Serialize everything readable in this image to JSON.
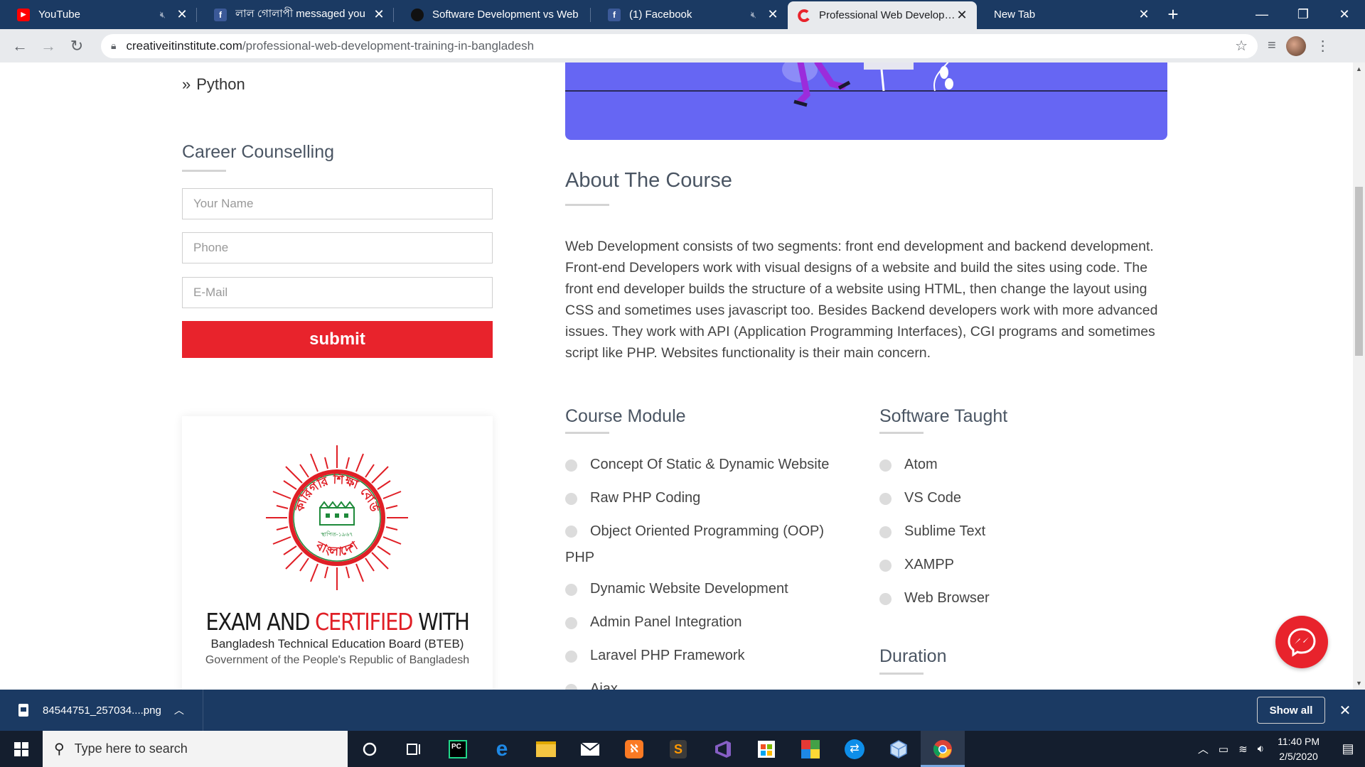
{
  "browser": {
    "tabs": [
      {
        "title": "YouTube",
        "favicon": "youtube-icon",
        "muted": true,
        "active": false
      },
      {
        "title": "লাল গোলাপী messaged you",
        "favicon": "facebook-icon",
        "muted": false,
        "active": false
      },
      {
        "title": "Software Development vs Web",
        "favicon": "github-icon",
        "muted": false,
        "active": false
      },
      {
        "title": "(1) Facebook",
        "favicon": "facebook-icon",
        "muted": true,
        "active": false
      },
      {
        "title": "Professional Web Development",
        "favicon": "creative-it-icon",
        "muted": false,
        "active": true
      },
      {
        "title": "New Tab",
        "favicon": "",
        "muted": false,
        "active": false
      }
    ],
    "url_host": "creativeitinstitute.com",
    "url_path": "/professional-web-development-training-in-bangladesh"
  },
  "sidebar": {
    "list_tail_item": "Python",
    "career": {
      "heading": "Career Counselling",
      "name_placeholder": "Your Name",
      "phone_placeholder": "Phone",
      "email_placeholder": "E-Mail",
      "submit_label": "submit"
    },
    "certificate": {
      "title_part1": "EXAM AND ",
      "title_highlight": "CERTIFIED",
      "title_part2": " WITH",
      "board": "Bangladesh Technical Education Board (BTEB)",
      "government": "Government of the People's Republic of Bangladesh",
      "seal_text_top": "কারিগরি শিক্ষা বোর্ড",
      "seal_text_bottom": "বাংলাদেশ",
      "seal_year": "স্থাপিত-১৯৬৭"
    }
  },
  "main": {
    "about": {
      "heading": "About The Course",
      "body": "Web Development consists of two segments: front end development and backend development. Front-end Developers work with visual designs of a website and build the sites using code. The front end developer builds the structure of a website using HTML, then change the layout using CSS and sometimes uses javascript too. Besides Backend developers work with more advanced issues. They work with API (Application Programming Interfaces), CGI programs and sometimes script like PHP. Websites functionality is their main concern."
    },
    "course_module": {
      "heading": "Course Module",
      "items": [
        "Concept Of Static & Dynamic Website",
        "Raw PHP Coding",
        "Object Oriented Programming (OOP) PHP",
        "Dynamic Website Development",
        "Admin Panel Integration",
        "Laravel PHP Framework",
        "Ajax"
      ]
    },
    "software_taught": {
      "heading": "Software Taught",
      "items": [
        "Atom",
        "VS Code",
        "Sublime Text",
        "XAMPP",
        "Web Browser"
      ]
    },
    "duration": {
      "heading": "Duration"
    }
  },
  "downloads": {
    "file_name": "84544751_257034....png",
    "show_all_label": "Show all"
  },
  "taskbar": {
    "search_placeholder": "Type here to search",
    "time": "11:40 PM",
    "date": "2/5/2020",
    "apps": [
      "cortana-icon",
      "task-view-icon",
      "pycharm-icon",
      "edge-icon",
      "file-explorer-icon",
      "mail-icon",
      "xampp-icon",
      "sublime-icon",
      "visual-studio-icon",
      "store-icon",
      "winrar-icon",
      "teamviewer-icon",
      "virtualbox-icon",
      "chrome-icon"
    ]
  },
  "colors": {
    "accent_red": "#e8232c",
    "hero_purple": "#6666f3",
    "chrome_dark": "#1b3a63"
  }
}
